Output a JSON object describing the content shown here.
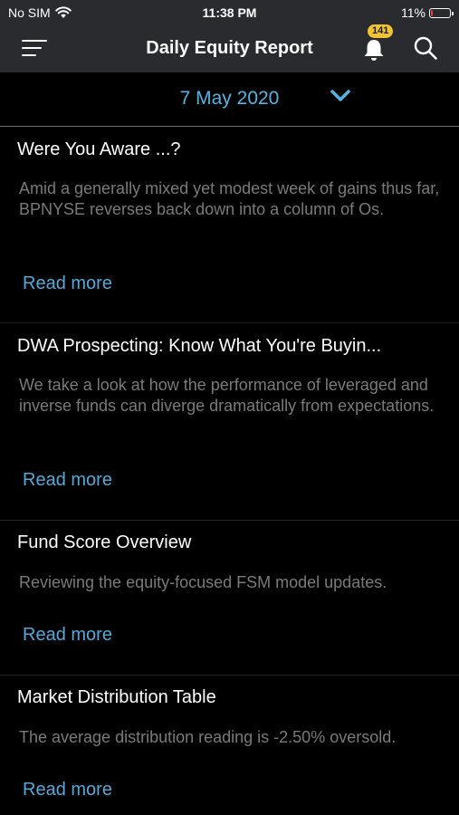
{
  "status_bar": {
    "carrier": "No SIM",
    "time": "11:38 PM",
    "battery_percent": "11%",
    "battery_level": 0.11
  },
  "nav": {
    "title": "Daily Equity Report",
    "notification_count": "141",
    "icons": [
      "menu-icon",
      "bell-icon",
      "search-icon"
    ]
  },
  "date_selector": {
    "date": "7 May 2020"
  },
  "colors": {
    "accent": "#56b4e0",
    "badge": "#f2c230",
    "battery_low": "#e53935"
  },
  "articles": [
    {
      "title": "Were You Aware ...?",
      "summary": "Amid a generally mixed yet modest week of gains thus far, BPNYSE reverses back down into a column of Os.",
      "link": "Read more"
    },
    {
      "title": "DWA Prospecting: Know What You're Buyin...",
      "summary": "We take a look at how the performance of leveraged and inverse funds can diverge dramatically from expectations.",
      "link": "Read more"
    },
    {
      "title": "Fund Score Overview",
      "summary": "Reviewing the equity-focused FSM model updates.",
      "link": "Read more"
    },
    {
      "title": "Market Distribution Table",
      "summary": "The average distribution reading is -2.50% oversold.",
      "link": "Read more"
    }
  ]
}
